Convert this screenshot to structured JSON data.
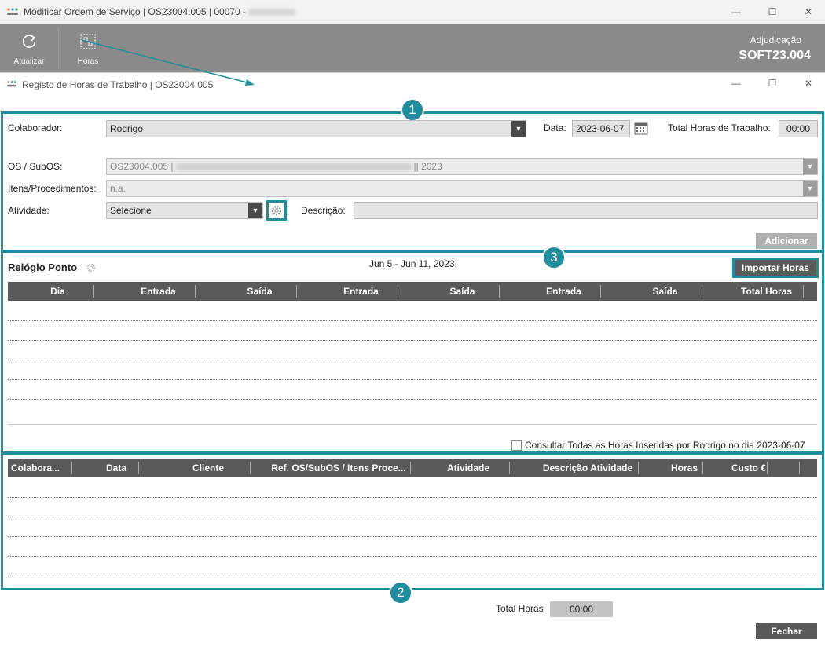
{
  "window": {
    "title_prefix": "Modificar Ordem de Serviço | OS23004.005 | 00070 -",
    "minimize": "—",
    "maximize": "☐",
    "close": "✕"
  },
  "toolbar": {
    "refresh_label": "Atualizar",
    "hours_label": "Horas",
    "adjudicacao_label": "Adjudicação",
    "adjudicacao_code": "SOFT23.004"
  },
  "dialog": {
    "title": "Registo de Horas de Trabalho | OS23004.005"
  },
  "badges": {
    "one": "1",
    "two": "2",
    "three": "3"
  },
  "form": {
    "colaborador_label": "Colaborador:",
    "colaborador_value": "Rodrigo",
    "data_label": "Data:",
    "data_value": "2023-06-07",
    "total_label": "Total Horas de Trabalho:",
    "total_value": "00:00",
    "os_label": "OS / SubOS:",
    "os_value_start": "OS23004.005 |",
    "os_value_end": "|| 2023",
    "itens_label": "Itens/Procedimentos:",
    "itens_value": "n.a.",
    "atividade_label": "Atividade:",
    "atividade_value": "Selecione",
    "descricao_label": "Descrição:",
    "descricao_value": "",
    "add_button": "Adicionar"
  },
  "clock": {
    "title": "Relógio Ponto",
    "week": "Jun 5 - Jun 11, 2023",
    "import_button": "Importar Horas",
    "columns": [
      "Dia",
      "Entrada",
      "Saída",
      "Entrada",
      "Saída",
      "Entrada",
      "Saída",
      "Total Horas"
    ],
    "consult_label": "Consultar Todas as Horas Inseridas por Rodrigo no dia 2023-06-07"
  },
  "hours_grid": {
    "columns": [
      "Colabora...",
      "Data",
      "Cliente",
      "Ref. OS/SubOS / Itens Proce...",
      "Atividade",
      "Descrição Atividade",
      "Horas",
      "Custo €"
    ]
  },
  "footer": {
    "total_label": "Total Horas",
    "total_value": "00:00",
    "close_button": "Fechar"
  },
  "colors": {
    "accent": "#1e8e9e",
    "toolbar": "#8a8a8a",
    "grid_header": "#5a5a5a"
  }
}
